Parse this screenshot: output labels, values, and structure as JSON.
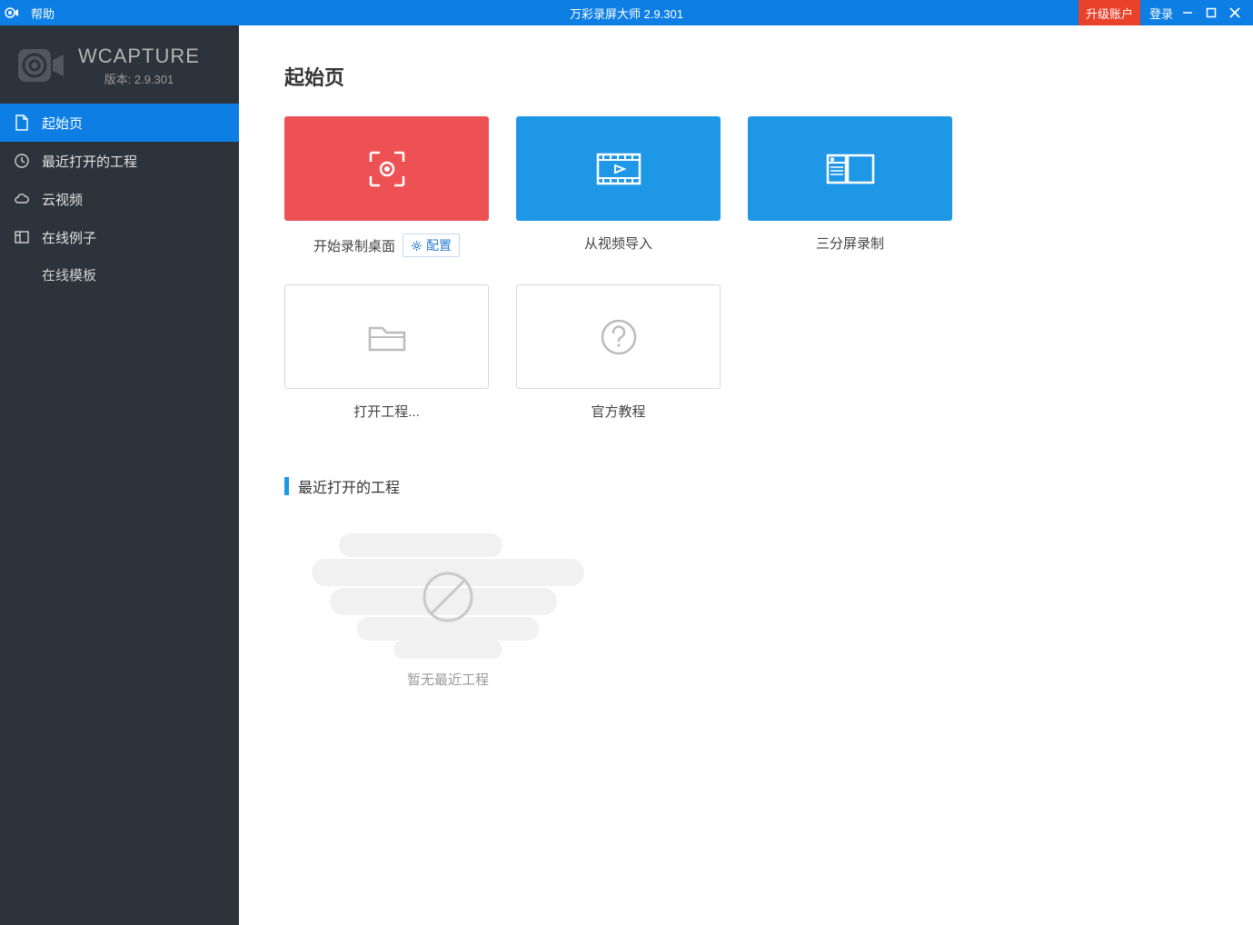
{
  "titlebar": {
    "help": "帮助",
    "appTitle": "万彩录屏大师 2.9.301",
    "upgrade": "升级账户",
    "login": "登录"
  },
  "brand": {
    "name": "WCAPTURE",
    "versionLabel": "版本: 2.9.301"
  },
  "nav": {
    "items": [
      {
        "label": "起始页"
      },
      {
        "label": "最近打开的工程"
      },
      {
        "label": "云视频"
      },
      {
        "label": "在线例子"
      }
    ],
    "sub": "在线模板"
  },
  "main": {
    "pageTitle": "起始页",
    "cardsTop": {
      "record": "开始录制桌面",
      "config": "配置",
      "importVideo": "从视频导入",
      "triple": "三分屏录制"
    },
    "cardsBottom": {
      "openProject": "打开工程...",
      "tutorial": "官方教程"
    },
    "recentSection": "最近打开的工程",
    "emptyText": "暂无最近工程"
  }
}
